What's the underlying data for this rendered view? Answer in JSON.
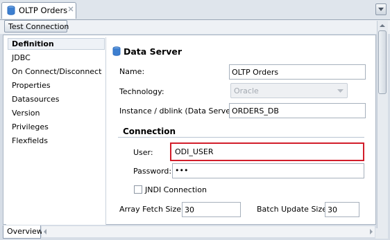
{
  "tab": {
    "title": "OLTP Orders"
  },
  "toolbar": {
    "test_connection": "Test Connection"
  },
  "nav": {
    "items": [
      "Definition",
      "JDBC",
      "On Connect/Disconnect",
      "Properties",
      "Datasources",
      "Version",
      "Privileges",
      "Flexfields"
    ],
    "selected": "Definition"
  },
  "data_server": {
    "title": "Data Server",
    "name_label": "Name:",
    "name_value": "OLTP Orders",
    "technology_label": "Technology:",
    "technology_value": "Oracle",
    "instance_label": "Instance / dblink (Data Server):",
    "instance_value": "ORDERS_DB"
  },
  "connection": {
    "title": "Connection",
    "user_label": "User:",
    "user_value": "ODI_USER",
    "password_label": "Password:",
    "password_value": "•••",
    "jndi_label": "JNDI Connection"
  },
  "fetch": {
    "array_fetch_label": "Array Fetch Size:",
    "array_fetch_value": "30",
    "batch_update_label": "Batch Update Size:",
    "batch_update_value": "30"
  },
  "bottom": {
    "overview_tab": "Overview"
  },
  "colors": {
    "highlight": "#d21d2a",
    "db_icon": "#2f6fc0"
  }
}
